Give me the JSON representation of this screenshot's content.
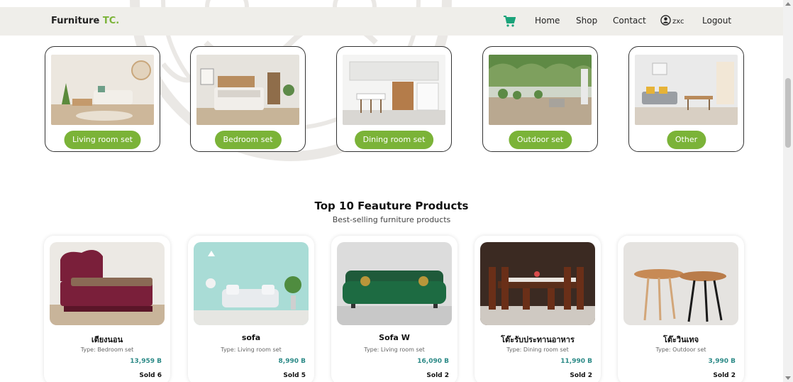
{
  "navbar": {
    "brand_main": "Furniture ",
    "brand_accent": "TC.",
    "links": {
      "home": "Home",
      "shop": "Shop",
      "contact": "Contact",
      "user": "zxc",
      "logout": "Logout"
    }
  },
  "categories": [
    {
      "label": "Living room set"
    },
    {
      "label": "Bedroom set"
    },
    {
      "label": "Dining room set"
    },
    {
      "label": "Outdoor set"
    },
    {
      "label": "Other"
    }
  ],
  "featured": {
    "title": "Top 10 Feauture Products",
    "subtitle": "Best-selling furniture products"
  },
  "products": [
    {
      "name": "เตียงนอน",
      "type": "Type: Bedroom set",
      "price": "13,959 B",
      "sold": "Sold 6"
    },
    {
      "name": "sofa",
      "type": "Type: Living room set",
      "price": "8,990 B",
      "sold": "Sold 5"
    },
    {
      "name": "Sofa W",
      "type": "Type: Living room set",
      "price": "16,090 B",
      "sold": "Sold 2"
    },
    {
      "name": "โต๊ะรับประทานอาหาร",
      "type": "Type: Dining room set",
      "price": "11,990 B",
      "sold": "Sold 2"
    },
    {
      "name": "โต๊ะวินเทจ",
      "type": "Type: Outdoor set",
      "price": "3,990 B",
      "sold": "Sold 2"
    }
  ],
  "colors": {
    "accent_green": "#7bb338",
    "price_teal": "#2c8a87",
    "navbar_bg": "#efeeea"
  },
  "icons": {
    "cart": "cart-icon",
    "user": "user-circle-icon"
  }
}
